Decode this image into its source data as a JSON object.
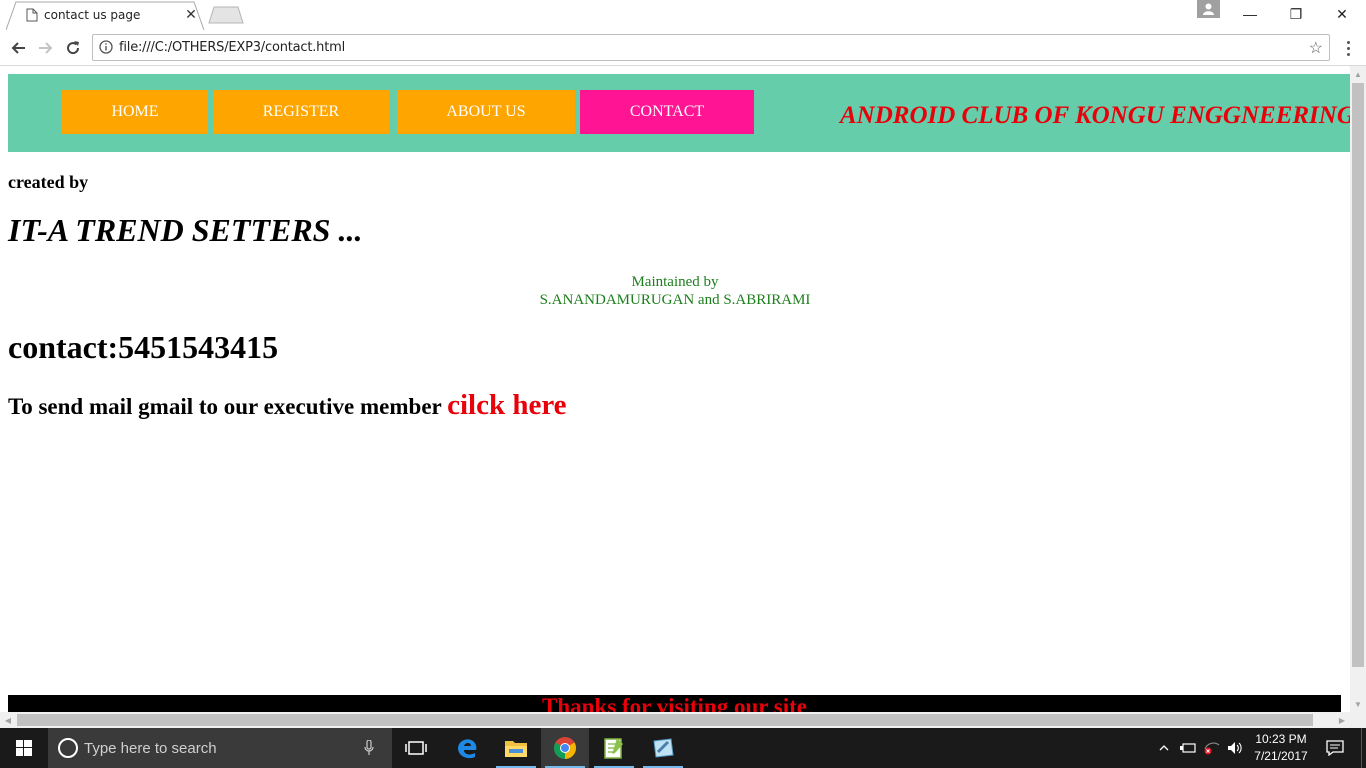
{
  "browser": {
    "tab_title": "contact us page",
    "tab_close": "✕",
    "url": "file:///C:/OTHERS/EXP3/contact.html",
    "window_minimize": "—",
    "window_restore": "❐",
    "window_close": "✕",
    "star": "☆"
  },
  "page": {
    "nav": {
      "items": [
        "HOME",
        "REGISTER",
        "ABOUT US",
        "CONTACT"
      ],
      "active_item": "CONTACT",
      "colors": {
        "header_bg": "#66cdaa",
        "item_bg": "#ffa500",
        "active_bg": "#ff1493"
      }
    },
    "club_title": "ANDROID CLUB OF KONGU ENGGNEERING",
    "created_by": "created by",
    "team_name": "IT-A TREND SETTERS ...",
    "maintained_by_label": "Maintained by",
    "maintainers": "S.ANANDAMURUGAN and S.ABRIRAMI",
    "contact": "contact:5451543415",
    "mail_text": "To send mail gmail to our executive member ",
    "mail_link": "cilck here",
    "footer": "Thanks for visiting our site"
  },
  "taskbar": {
    "search_placeholder": "Type here to search",
    "time": "10:23 PM",
    "date": "7/21/2017",
    "apps": [
      "task-view",
      "edge",
      "file-explorer",
      "chrome",
      "notepad-plus",
      "paint"
    ]
  }
}
